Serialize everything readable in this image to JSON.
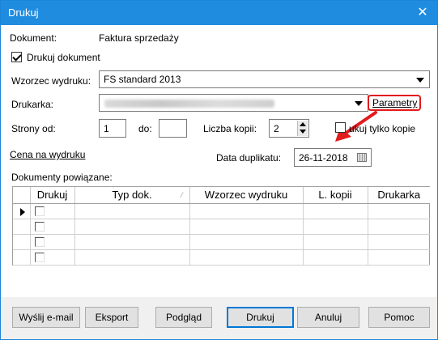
{
  "window": {
    "title": "Drukuj",
    "close_glyph": "✕"
  },
  "document": {
    "label": "Dokument:",
    "value": "Faktura sprzedaży"
  },
  "print_document": {
    "label": "Drukuj dokument",
    "checked": true
  },
  "template": {
    "label": "Wzorzec wydruku:",
    "value": "FS standard 2013"
  },
  "printer": {
    "label": "Drukarka:",
    "value": "",
    "parameters_link": "Parametry"
  },
  "pages": {
    "from_label": "Strony od:",
    "from_value": "1",
    "to_label": "do:",
    "to_value": ""
  },
  "copies": {
    "label": "Liczba kopii:",
    "value": "2"
  },
  "print_copies_only": {
    "label": "Drukuj tylko kopie",
    "visible_label": "ukuj tylko kopie",
    "checked": false
  },
  "price_link": "Cena na wydruku",
  "duplicate_date": {
    "label": "Data duplikatu:",
    "value": "26-11-2018"
  },
  "related_docs": {
    "label": "Dokumenty powiązane:",
    "columns": [
      "",
      "Drukuj",
      "Typ dok.",
      "Wzorzec wydruku",
      "L. kopii",
      "Drukarka"
    ],
    "rows": [
      {
        "current": true,
        "print": false,
        "type": "",
        "template": "",
        "copies": "",
        "printer": ""
      },
      {
        "current": false,
        "print": false,
        "type": "",
        "template": "",
        "copies": "",
        "printer": ""
      },
      {
        "current": false,
        "print": false,
        "type": "",
        "template": "",
        "copies": "",
        "printer": ""
      },
      {
        "current": false,
        "print": false,
        "type": "",
        "template": "",
        "copies": "",
        "printer": ""
      }
    ]
  },
  "buttons": {
    "email": "Wyślij e-mail",
    "export": "Eksport",
    "preview": "Podgląd",
    "print": "Drukuj",
    "cancel": "Anuluj",
    "help": "Pomoc"
  },
  "colors": {
    "titlebar": "#1f8ce0",
    "annotation": "#e21b1b"
  }
}
